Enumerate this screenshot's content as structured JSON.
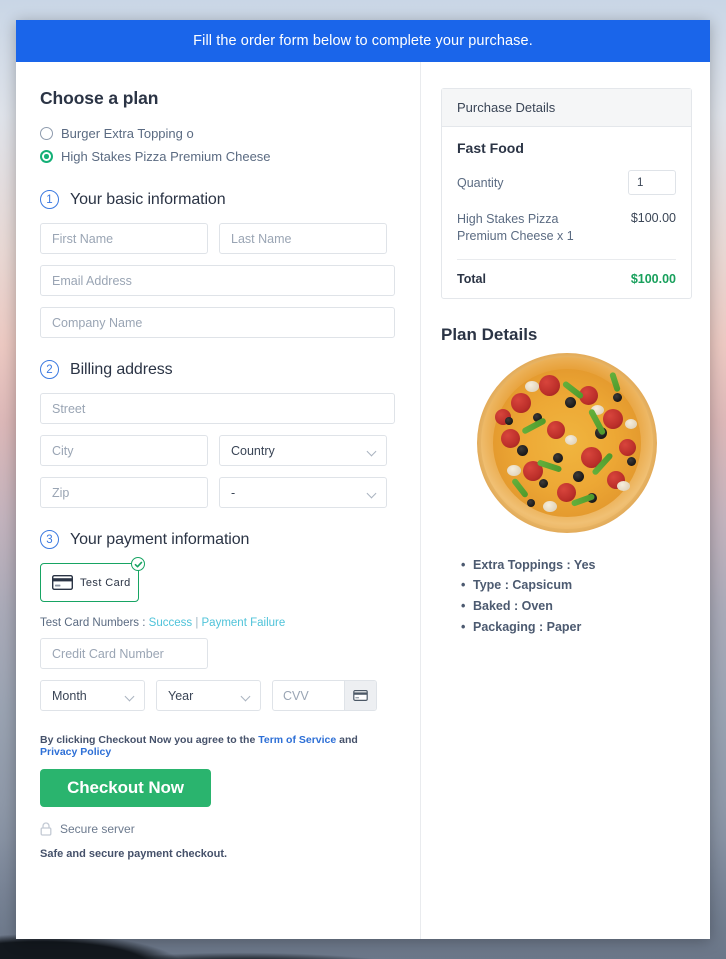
{
  "banner": {
    "text": "Fill the order form below to complete your purchase."
  },
  "plan": {
    "heading": "Choose a plan",
    "options": [
      {
        "label": "Burger Extra Topping o",
        "selected": false
      },
      {
        "label": "High Stakes Pizza Premium Cheese",
        "selected": true
      }
    ]
  },
  "steps": {
    "basic": {
      "number": "1",
      "label": "Your basic information"
    },
    "billing": {
      "number": "2",
      "label": "Billing address"
    },
    "payment": {
      "number": "3",
      "label": "Your payment information"
    }
  },
  "basic_fields": {
    "first_name": {
      "placeholder": "First Name",
      "value": ""
    },
    "last_name": {
      "placeholder": "Last Name",
      "value": ""
    },
    "email": {
      "placeholder": "Email Address",
      "value": ""
    },
    "company": {
      "placeholder": "Company Name",
      "value": ""
    }
  },
  "billing_fields": {
    "street": {
      "placeholder": "Street",
      "value": ""
    },
    "city": {
      "placeholder": "City",
      "value": ""
    },
    "country": {
      "selected": "Country"
    },
    "zip": {
      "placeholder": "Zip",
      "value": ""
    },
    "state": {
      "selected": "-"
    }
  },
  "payment": {
    "method": {
      "label": "Test  Card",
      "selected": true,
      "icon": "credit-card-icon"
    },
    "test_numbers": {
      "prefix": "Test Card Numbers : ",
      "success": "Success",
      "separator": " | ",
      "failure": "Payment Failure"
    },
    "card_number": {
      "placeholder": "Credit Card Number",
      "value": ""
    },
    "month": {
      "selected": "Month"
    },
    "year": {
      "selected": "Year"
    },
    "cvv": {
      "placeholder": "CVV",
      "value": ""
    }
  },
  "footer": {
    "terms_prefix": "By clicking Checkout Now you agree to the ",
    "terms_link": "Term of Service",
    "terms_mid": " and ",
    "privacy_link": "Privacy Policy",
    "checkout_label": "Checkout Now",
    "secure_label": "Secure server",
    "safe_note": "Safe and secure payment checkout."
  },
  "purchase": {
    "panel_title": "Purchase Details",
    "product_title": "Fast Food",
    "quantity_label": "Quantity",
    "quantity_value": "1",
    "line_item_name": "High Stakes Pizza Premium Cheese x 1",
    "line_item_price": "$100.00",
    "total_label": "Total",
    "total_value": "$100.00",
    "total_color": "#18a05c"
  },
  "plan_details": {
    "title": "Plan Details",
    "image_alt": "pizza-image",
    "features": [
      "Extra Toppings : Yes",
      "Type : Capsicum",
      "Baked : Oven",
      "Packaging : Paper"
    ]
  },
  "colors": {
    "banner_blue": "#1a65ea",
    "checkout_green": "#2ab46e",
    "radio_green": "#15b077",
    "step_blue": "#3b79e0",
    "link_cyan": "#4fc3d9",
    "terms_link_blue": "#2d6fd6"
  }
}
